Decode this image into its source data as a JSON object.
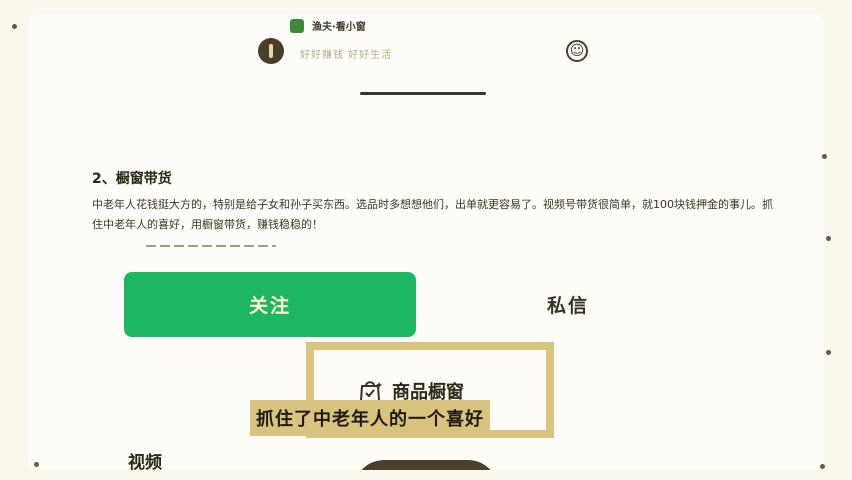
{
  "header": {
    "app_name": "渔夫·看小窗",
    "signature": "好好赚钱 好好生活"
  },
  "section": {
    "title": "2、橱窗带货",
    "body": "中老年人花钱挺大方的，特别是给子女和孙子买东西。选品时多想想他们，出单就更容易了。视频号带货很简单，就100块钱押金的事儿。抓住中老年人的喜好，用橱窗带货，赚钱稳稳的！"
  },
  "actions": {
    "follow_label": "关注",
    "message_label": "私信"
  },
  "shop": {
    "label": "商品橱窗",
    "icon": "shopping-bag-icon"
  },
  "caption": "抓住了中老年人的一个喜好",
  "tabs": {
    "video_label": "视频"
  },
  "colors": {
    "follow_button": "#1db663",
    "highlight_border": "#d8c47e",
    "background": "#fbf8ee"
  }
}
